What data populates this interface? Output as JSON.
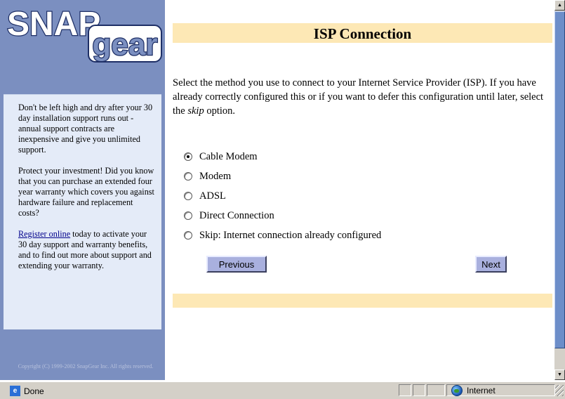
{
  "logo": {
    "line1": "SNAP",
    "line2": "gear"
  },
  "sidebar": {
    "para1": "Don't be left high and dry after your 30 day installation support runs out - annual support contracts are inexpensive and give you unlimited support.",
    "para2": "Protect your investment! Did you know that you can purchase an extended four year warranty which covers you against hardware failure and replacement costs?",
    "register_link": "Register online",
    "para3_rest": " today to activate your 30 day support and warranty benefits, and to find out more about support and extending your warranty.",
    "copyright": "Copyright (C) 1999-2002 SnapGear Inc. All rights reserved."
  },
  "main": {
    "title": "ISP Connection",
    "intro_before": "Select the method you use to connect to your Internet Service Provider (ISP). If you have already correctly configured this or if you want to defer this configuration until later, select the ",
    "intro_em": "skip",
    "intro_after": " option.",
    "options": [
      {
        "label": "Cable Modem",
        "checked": true
      },
      {
        "label": "Modem",
        "checked": false
      },
      {
        "label": "ADSL",
        "checked": false
      },
      {
        "label": "Direct Connection",
        "checked": false
      },
      {
        "label": "Skip: Internet connection already configured",
        "checked": false
      }
    ],
    "previous_label": "Previous",
    "next_label": "Next"
  },
  "status": {
    "text": "Done",
    "zone": "Internet"
  },
  "colors": {
    "sidebar": "#7b8fc0",
    "sidebar_box": "#e4ebf8",
    "title_bar": "#fde8b5",
    "button": "#a9b0de"
  },
  "icons": {
    "status": "page-done-icon",
    "zone": "internet-globe-icon",
    "scroll_up": "arrow-up-icon",
    "scroll_down": "arrow-down-icon"
  }
}
